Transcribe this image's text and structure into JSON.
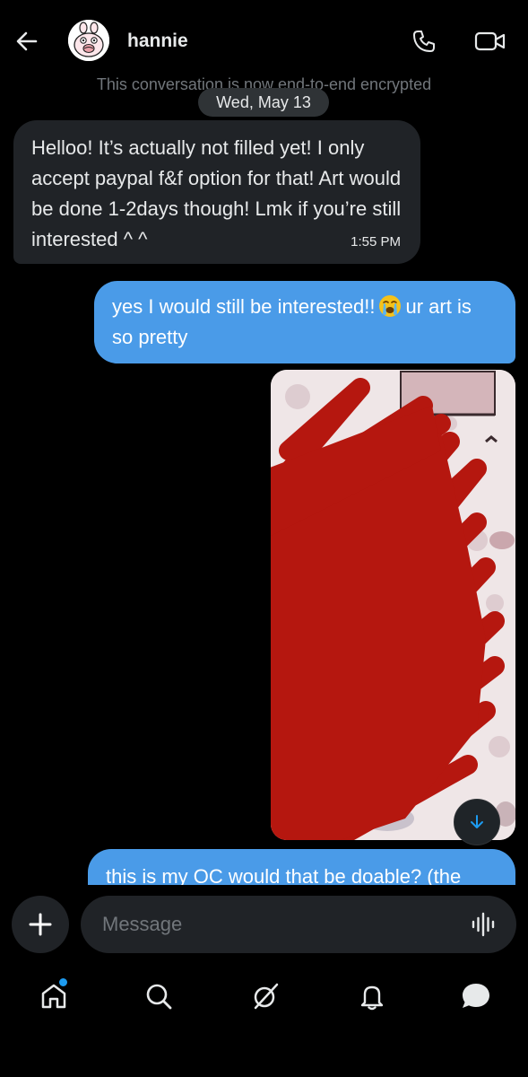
{
  "header": {
    "username": "hannie",
    "back_icon": "arrow-left-icon",
    "call_icon": "phone-icon",
    "video_icon": "video-camera-icon"
  },
  "conversation": {
    "encryption_note": "This conversation is now end-to-end encrypted",
    "date_divider": "Wed, May 13",
    "messages": [
      {
        "direction": "received",
        "text": "Helloo! It’s actually not filled yet! I only accept paypal f&f option for that! Art would be done 1-2days though! Lmk if you’re still interested ^ ^",
        "time": "1:55 PM"
      },
      {
        "direction": "sent",
        "text_before_emoji": "yes I would still be interested!!",
        "emoji": "loudly-crying-face",
        "text_after_emoji": "ur art is so pretty"
      },
      {
        "direction": "sent",
        "type": "image",
        "description": "redacted"
      },
      {
        "direction": "sent",
        "text": "this is my OC would that be doable? (the"
      }
    ]
  },
  "composer": {
    "placeholder": "Message",
    "plus_icon": "plus-icon",
    "voice_icon": "voice-waveform-icon"
  },
  "bottom_nav": {
    "items": [
      "home-icon",
      "search-icon",
      "grok-icon",
      "notifications-icon",
      "messages-icon"
    ]
  },
  "colors": {
    "background": "#000000",
    "received_bubble": "#202327",
    "sent_bubble": "#4a9be8",
    "muted_text": "#71767b",
    "accent": "#1d9bf0",
    "redaction": "#b5170f"
  }
}
